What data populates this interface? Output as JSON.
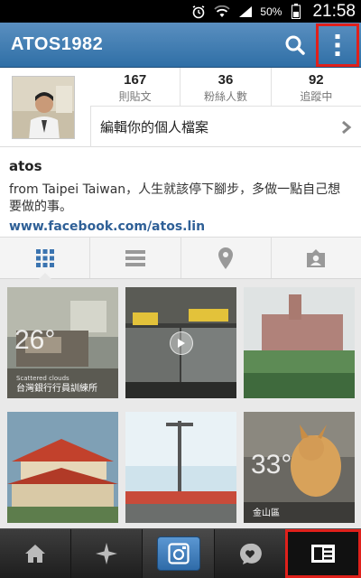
{
  "status_bar": {
    "battery_percent": "50%",
    "time": "21:58"
  },
  "header": {
    "title": "ATOS1982"
  },
  "profile": {
    "stats": [
      {
        "value": "167",
        "label": "則貼文"
      },
      {
        "value": "36",
        "label": "粉絲人數"
      },
      {
        "value": "92",
        "label": "追蹤中"
      }
    ],
    "edit_label": "編輯你的個人檔案"
  },
  "bio": {
    "name": "atos",
    "text": "from Taipei Taiwan，人生就該停下腳步，多做一點自己想要做的事。",
    "link": "www.facebook.com/atos.lin"
  },
  "photos": [
    {
      "temp": "26°",
      "condition": "Scattered clouds",
      "location": "台灣銀行行員訓練所"
    },
    {
      "temp": "",
      "condition": "",
      "location": ""
    },
    {
      "temp": "",
      "condition": "",
      "location": ""
    },
    {
      "temp": "",
      "condition": "",
      "location": ""
    },
    {
      "temp": "",
      "condition": "",
      "location": ""
    },
    {
      "temp": "33°",
      "condition": "",
      "location": "金山區"
    }
  ],
  "accent_colors": {
    "header_blue": "#2f6fa6",
    "highlight_red": "#e0201b",
    "link_blue": "#2f6097"
  }
}
